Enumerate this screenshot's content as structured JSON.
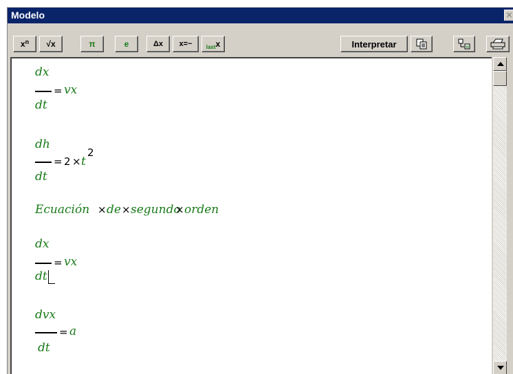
{
  "window": {
    "title": "Modelo"
  },
  "toolbar": {
    "power_base": "x",
    "power_exp": "n",
    "sqrt": "√x",
    "pi": "π",
    "e": "e",
    "delta": "Δx",
    "assign": "x=~",
    "last_sub": "last",
    "last_var": "x",
    "interpret": "Interpretar"
  },
  "equations": [
    {
      "num": "dx",
      "den": "dt",
      "eq": "=",
      "rhs": "vx"
    },
    {
      "num": "dh",
      "den": "dt",
      "eq": "=",
      "coef": "2",
      "times": "×",
      "var": "t",
      "exp": "2"
    },
    {
      "words": [
        "Ecuación",
        "de",
        "segundo",
        "orden"
      ],
      "times": "×"
    },
    {
      "num": "dx",
      "den": "dt",
      "eq": "=",
      "rhs": "vx"
    },
    {
      "num": "dvx",
      "den": "dt",
      "eq": "=",
      "rhs": "a"
    }
  ],
  "colors": {
    "title_bg": "#0a246a",
    "formula_green": "#1a7a1a",
    "chrome": "#d4d0c8"
  }
}
